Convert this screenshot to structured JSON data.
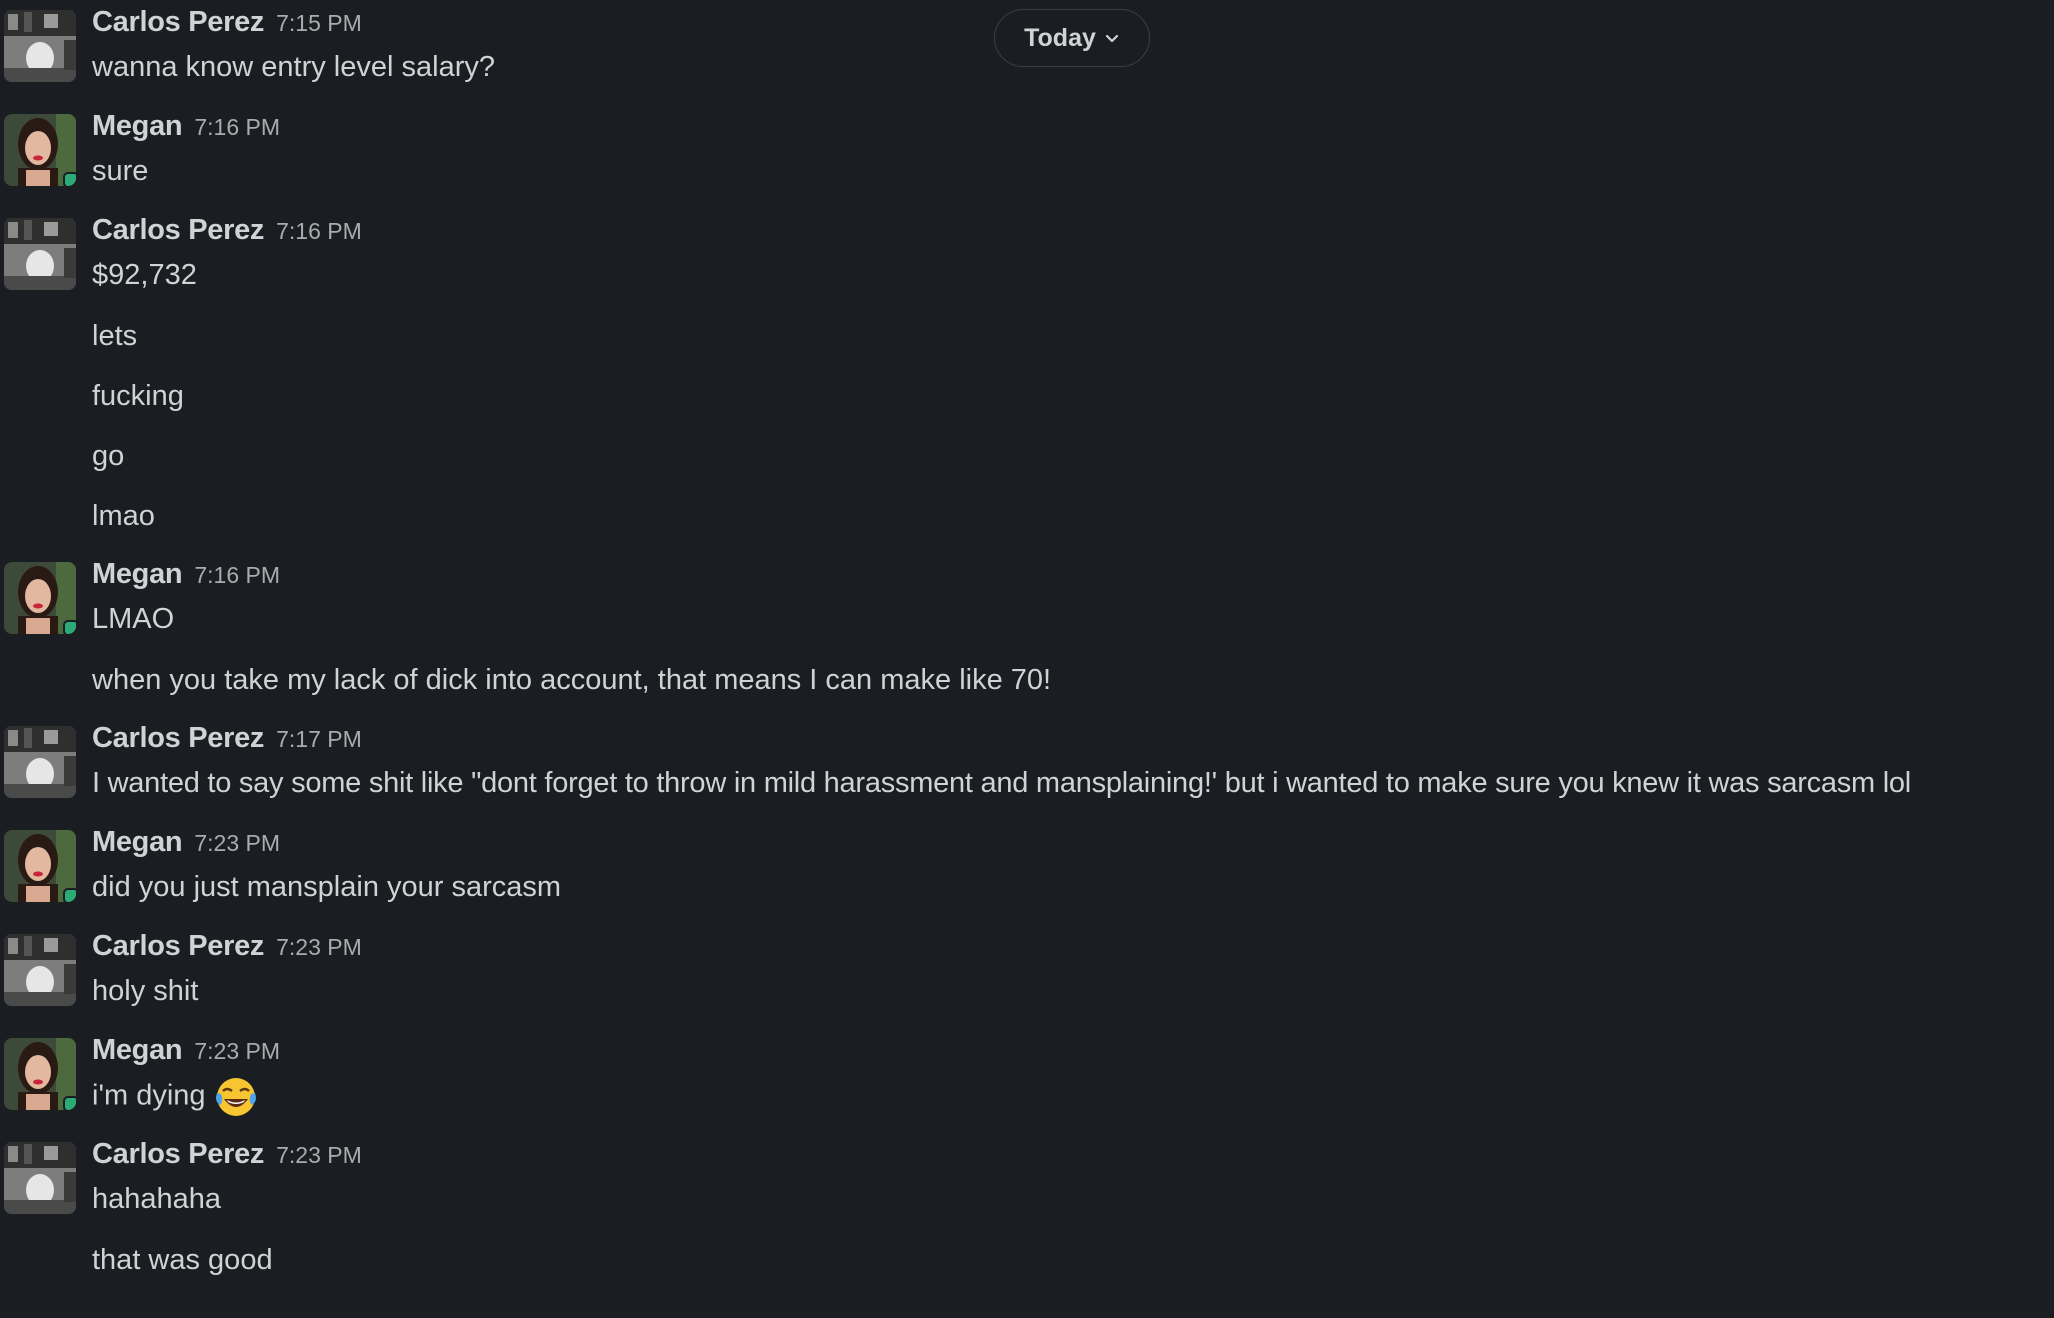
{
  "date_divider": {
    "label": "Today"
  },
  "groups": [
    {
      "author": "Carlos Perez",
      "time": "7:15 PM",
      "messages": [
        "wanna know entry level salary?"
      ]
    },
    {
      "author": "Megan",
      "time": "7:16 PM",
      "messages": [
        "sure"
      ]
    },
    {
      "author": "Carlos Perez",
      "time": "7:16 PM",
      "messages": [
        "$92,732",
        "lets",
        "fucking",
        "go",
        "lmao"
      ]
    },
    {
      "author": "Megan",
      "time": "7:16 PM",
      "messages": [
        "LMAO",
        "when you take my lack of dick into account, that means I can make like 70!"
      ]
    },
    {
      "author": "Carlos Perez",
      "time": "7:17 PM",
      "messages": [
        "I wanted to say some shit like \"dont forget to throw in mild harassment and mansplaining!' but i wanted to make sure you knew it was sarcasm lol"
      ]
    },
    {
      "author": "Megan",
      "time": "7:23 PM",
      "messages": [
        "did you just mansplain your sarcasm"
      ]
    },
    {
      "author": "Carlos Perez",
      "time": "7:23 PM",
      "messages": [
        "holy shit"
      ]
    },
    {
      "author": "Megan",
      "time": "7:23 PM",
      "messages": [
        "i'm dying"
      ],
      "emoji": "tears-of-joy-emoji"
    },
    {
      "author": "Carlos Perez",
      "time": "7:23 PM",
      "messages": [
        "hahahaha",
        "that was good"
      ]
    }
  ],
  "colors": {
    "background": "#1a1d21",
    "text": "#d1d2d3",
    "timestamp": "#ababad",
    "presence": "#2bac76"
  }
}
